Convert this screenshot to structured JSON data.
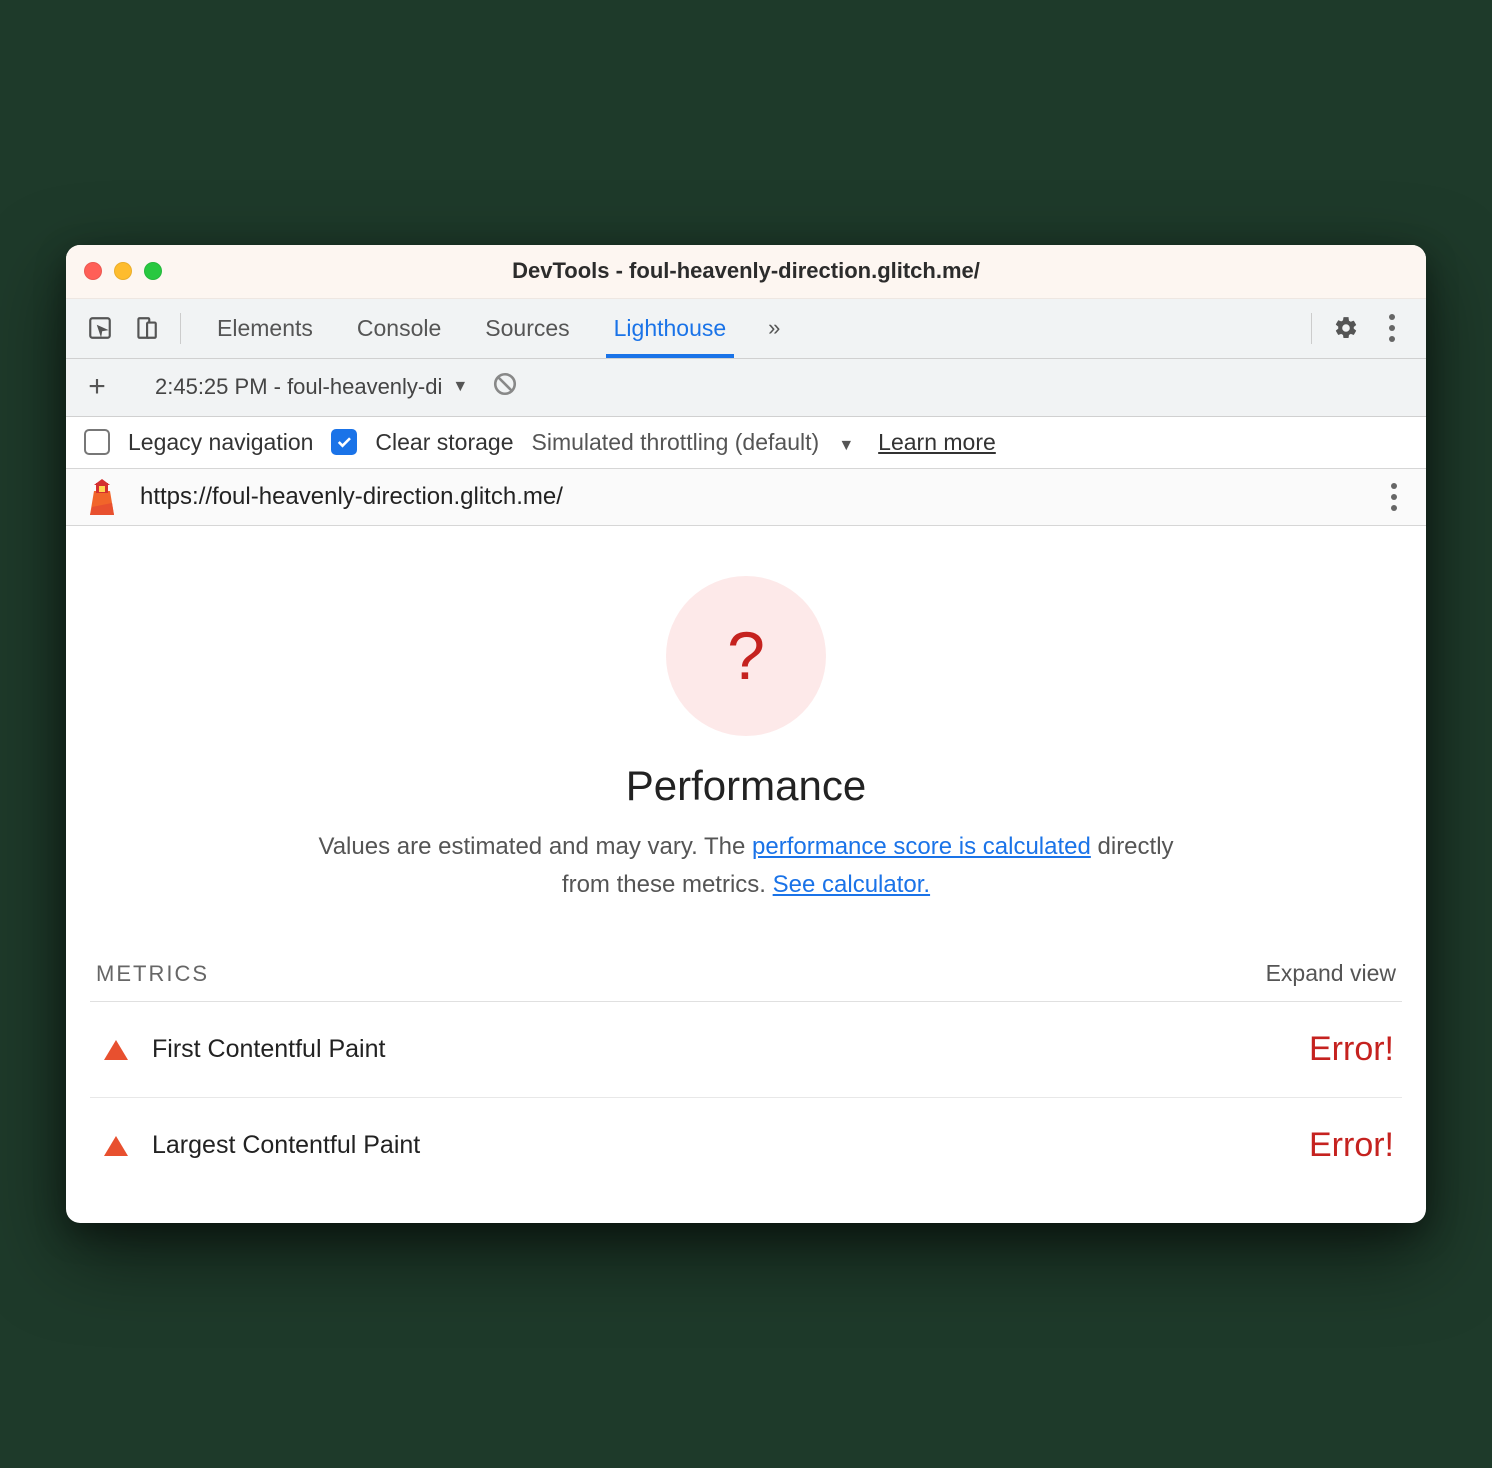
{
  "window": {
    "title": "DevTools - foul-heavenly-direction.glitch.me/"
  },
  "tabs": {
    "items": [
      "Elements",
      "Console",
      "Sources",
      "Lighthouse"
    ],
    "active_index": 3
  },
  "subbar": {
    "report_label": "2:45:25 PM - foul-heavenly-di"
  },
  "options": {
    "legacy_label": "Legacy navigation",
    "clear_label": "Clear storage",
    "throttling_label": "Simulated throttling (default)",
    "learn_more": "Learn more",
    "legacy_checked": false,
    "clear_checked": true
  },
  "urlbar": {
    "url": "https://foul-heavenly-direction.glitch.me/"
  },
  "report": {
    "gauge_symbol": "?",
    "title": "Performance",
    "desc_prefix": "Values are estimated and may vary. The ",
    "desc_link1": "performance score is calculated",
    "desc_mid": " directly from these metrics. ",
    "desc_link2": "See calculator."
  },
  "metrics": {
    "heading": "METRICS",
    "expand": "Expand view",
    "items": [
      {
        "name": "First Contentful Paint",
        "value": "Error!"
      },
      {
        "name": "Largest Contentful Paint",
        "value": "Error!"
      }
    ]
  }
}
